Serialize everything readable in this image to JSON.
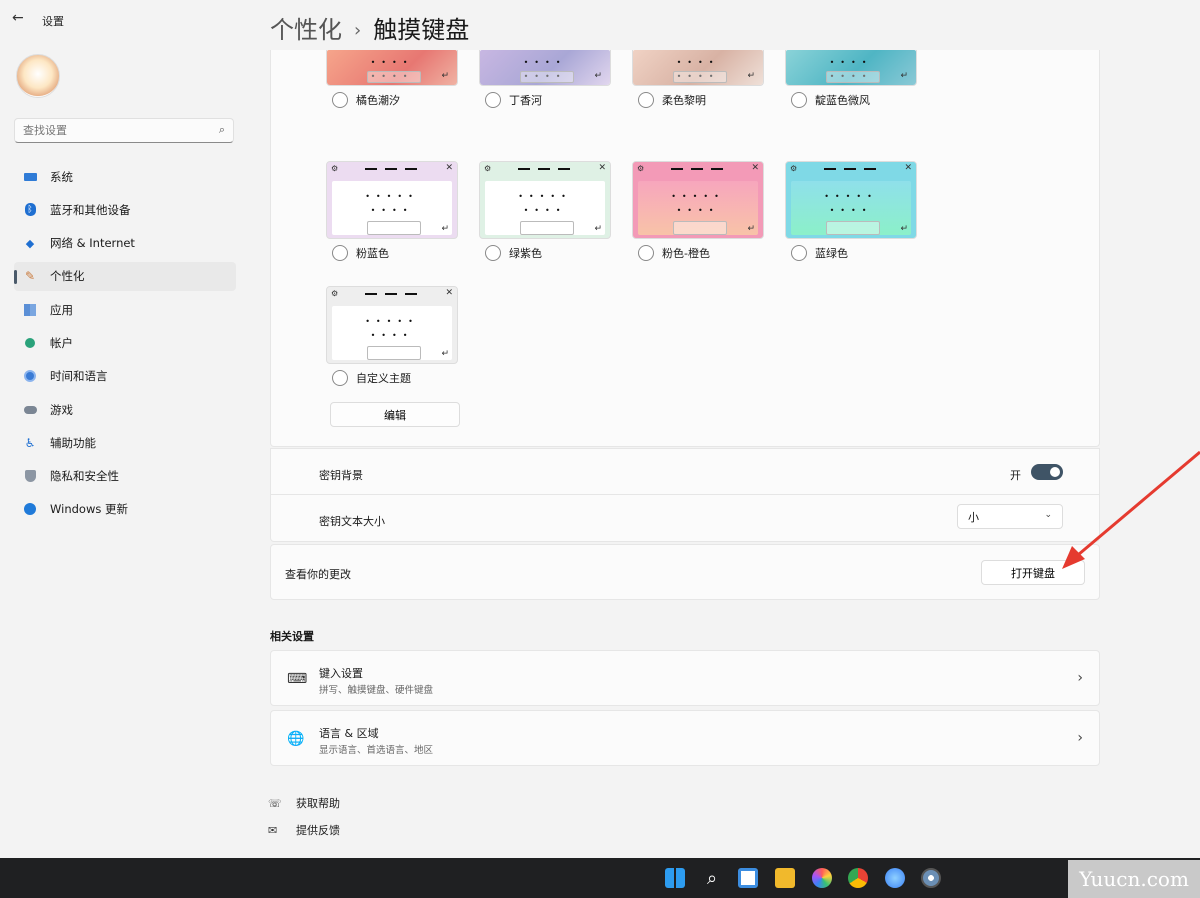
{
  "window": {
    "title": "设置",
    "back_icon": "back-arrow-icon"
  },
  "search": {
    "placeholder": "查找设置"
  },
  "sidebar": {
    "items": [
      {
        "label": "系统",
        "icon": "system-icon"
      },
      {
        "label": "蓝牙和其他设备",
        "icon": "bluetooth-icon"
      },
      {
        "label": "网络 & Internet",
        "icon": "wifi-icon"
      },
      {
        "label": "个性化",
        "icon": "brush-icon",
        "active": true
      },
      {
        "label": "应用",
        "icon": "apps-icon"
      },
      {
        "label": "帐户",
        "icon": "account-icon"
      },
      {
        "label": "时间和语言",
        "icon": "globe-clock-icon"
      },
      {
        "label": "游戏",
        "icon": "gamepad-icon"
      },
      {
        "label": "辅助功能",
        "icon": "accessibility-icon"
      },
      {
        "label": "隐私和安全性",
        "icon": "shield-icon"
      },
      {
        "label": "Windows 更新",
        "icon": "update-icon"
      }
    ]
  },
  "header": {
    "parent": "个性化",
    "separator": "›",
    "title": "触摸键盘"
  },
  "themes": [
    {
      "label": "橘色潮汐",
      "bar": "#f4a184",
      "body": "linear-gradient(135deg,#f6a58b,#e77772 60%,#f0b2a3)"
    },
    {
      "label": "丁香河",
      "bar": "#c7c1e3",
      "body": "linear-gradient(135deg,#c8b7e2,#a9a7d6 55%,#e1d6ee)"
    },
    {
      "label": "柔色黎明",
      "bar": "#e6c8bd",
      "body": "linear-gradient(135deg,#f0d2c4,#d8b2a4 55%,#efe0d8)"
    },
    {
      "label": "靛蓝色微风",
      "bar": "#76cbd2",
      "body": "linear-gradient(135deg,#8ad3d8,#4fb5c4 55%,#8ac9d6)"
    },
    {
      "label": "粉蓝色",
      "bar": "#ecdcf1",
      "body": "#ffffff"
    },
    {
      "label": "绿紫色",
      "bar": "#dff1e5",
      "body": "#ffffff"
    },
    {
      "label": "粉色-橙色",
      "bar": "#f39ab7",
      "body": "linear-gradient(180deg,#f7a6bd,#f8c3a8)"
    },
    {
      "label": "蓝绿色",
      "bar": "#7fd9e6",
      "body": "linear-gradient(180deg,#8fe0ea,#8cf0c9)"
    },
    {
      "label": "自定义主题",
      "bar": "#eeeeee",
      "body": "#ffffff"
    }
  ],
  "edit_button": "编辑",
  "key_background": {
    "label": "密钥背景",
    "state_label": "开",
    "on": true
  },
  "key_text_size": {
    "label": "密钥文本大小",
    "value": "小"
  },
  "preview": {
    "label": "查看你的更改",
    "button": "打开键盘"
  },
  "related": {
    "title": "相关设置",
    "items": [
      {
        "title": "键入设置",
        "subtitle": "拼写、触摸键盘、硬件键盘",
        "icon": "keyboard-icon"
      },
      {
        "title": "语言 & 区域",
        "subtitle": "显示语言、首选语言、地区",
        "icon": "language-icon"
      }
    ]
  },
  "help": {
    "get_help": "获取帮助",
    "feedback": "提供反馈"
  },
  "watermark": "Yuucn.com",
  "colors": {
    "accent": "#3f5466",
    "annotation_arrow": "#e53a2f",
    "taskbar": "#1f2022"
  }
}
